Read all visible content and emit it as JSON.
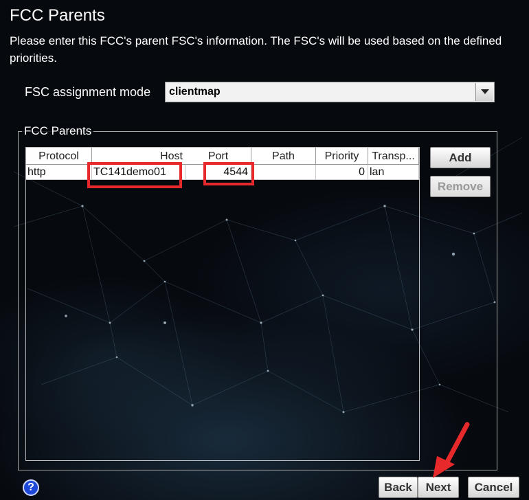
{
  "page": {
    "title": "FCC Parents",
    "description": "Please enter this FCC's parent FSC's information. The FSC's will be used based on the defined priorities."
  },
  "assignment": {
    "label": "FSC assignment mode",
    "value": "clientmap"
  },
  "parents_group": {
    "legend": "FCC Parents",
    "columns": [
      "Protocol",
      "Host",
      "Port",
      "Path",
      "Priority",
      "Transp..."
    ],
    "rows": [
      {
        "protocol": "http",
        "host": "TC141demo01",
        "port": "4544",
        "path": "",
        "priority": "0",
        "transport": "lan"
      }
    ]
  },
  "buttons": {
    "add": "Add",
    "remove": "Remove",
    "back": "Back",
    "next": "Next",
    "cancel": "Cancel",
    "help": "?"
  },
  "colors": {
    "highlight": "#e8292b",
    "help_icon": "#1d47d6",
    "background": "#06090e"
  }
}
